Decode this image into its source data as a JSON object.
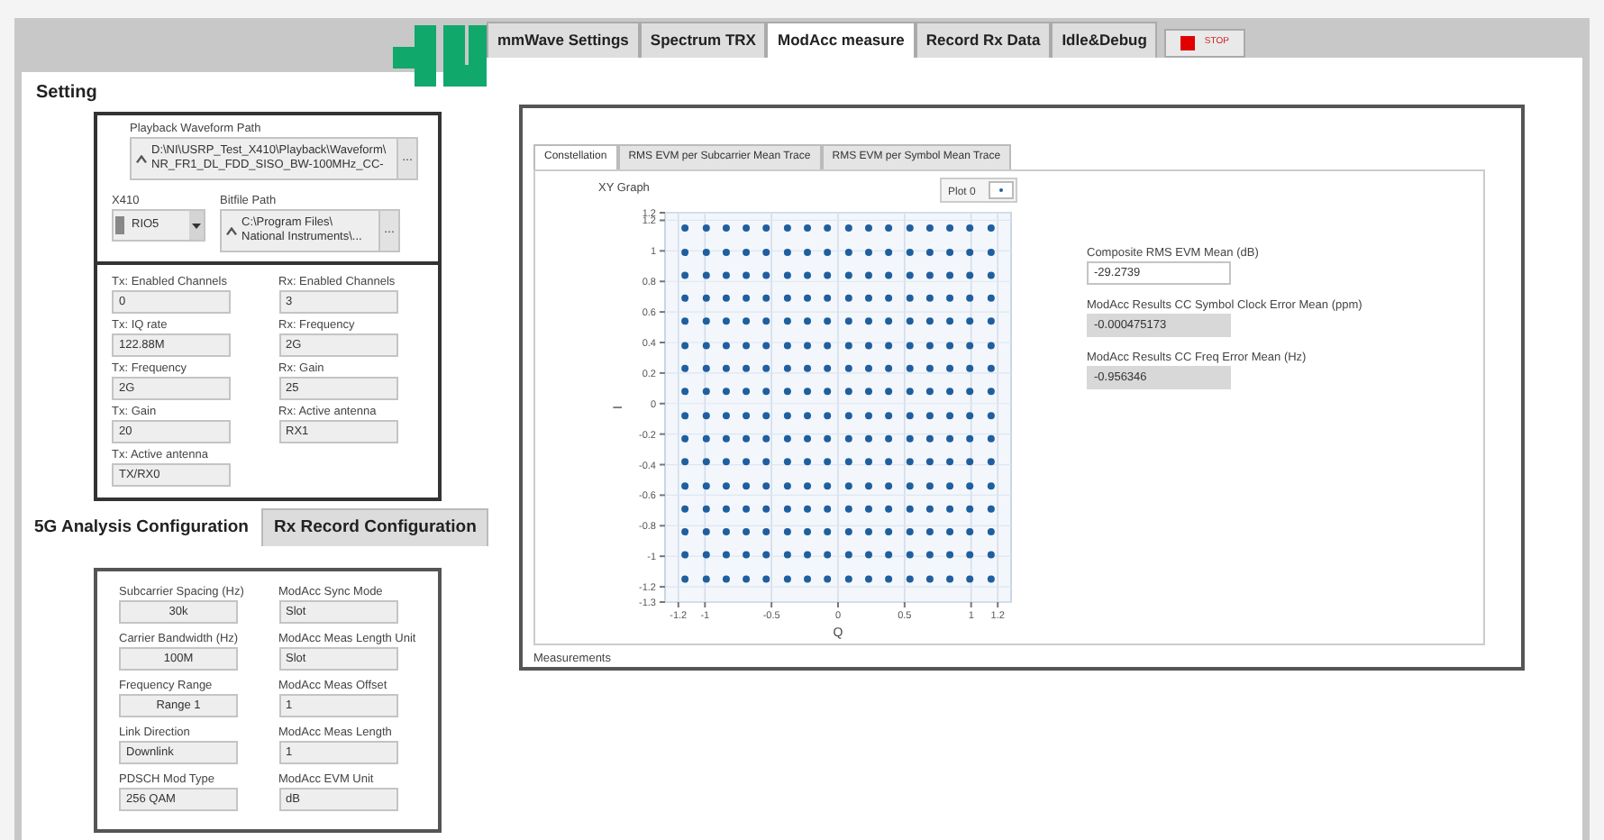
{
  "top_tabs": [
    {
      "label": "mmWave Settings",
      "selected": false
    },
    {
      "label": "Spectrum TRX",
      "selected": false
    },
    {
      "label": "ModAcc measure",
      "selected": true
    },
    {
      "label": "Record Rx Data",
      "selected": false
    },
    {
      "label": "Idle&Debug",
      "selected": false
    }
  ],
  "stop_button": {
    "label": "STOP"
  },
  "setting": {
    "title": "Setting",
    "playback_waveform_path": {
      "label": "Playback Waveform Path",
      "lines": [
        "D:\\NI\\USRP_Test_X410\\Playback\\Waveform\\",
        "NR_FR1_DL_FDD_SISO_BW-100MHz_CC-"
      ],
      "browse": "..."
    },
    "x410": {
      "label": "X410",
      "value": "RIO5"
    },
    "bitfile_path": {
      "label": "Bitfile Path",
      "lines": [
        "C:\\Program Files\\",
        "National Instruments\\..."
      ],
      "browse": "..."
    },
    "fields": [
      {
        "label": "Tx: Enabled Channels",
        "value": "0"
      },
      {
        "label": "Rx: Enabled Channels",
        "value": "3"
      },
      {
        "label": "Tx: IQ rate",
        "value": "122.88M"
      },
      {
        "label": "Rx: Frequency",
        "value": "2G"
      },
      {
        "label": "Tx: Frequency",
        "value": "2G"
      },
      {
        "label": "Rx: Gain",
        "value": "25"
      },
      {
        "label": "Tx: Gain",
        "value": "20"
      },
      {
        "label": "Rx: Active antenna",
        "value": "RX1"
      },
      {
        "label": "Tx: Active antenna",
        "value": "TX/RX0"
      }
    ]
  },
  "config_tabs": [
    {
      "label": "5G Analysis Configuration",
      "selected": true
    },
    {
      "label": "Rx Record Configuration",
      "selected": false
    }
  ],
  "analysis_fields": [
    {
      "label": "Subcarrier Spacing (Hz)",
      "value": "30k",
      "kind": "ring"
    },
    {
      "label": "ModAcc Sync Mode",
      "value": "Slot",
      "kind": "text"
    },
    {
      "label": "Carrier Bandwidth (Hz)",
      "value": "100M",
      "kind": "ring"
    },
    {
      "label": "ModAcc Meas Length Unit",
      "value": "Slot",
      "kind": "text"
    },
    {
      "label": "Frequency Range",
      "value": "Range 1",
      "kind": "ring"
    },
    {
      "label": "ModAcc Meas Offset",
      "value": "1",
      "kind": "text"
    },
    {
      "label": "Link Direction",
      "value": "Downlink",
      "kind": "text"
    },
    {
      "label": "ModAcc Meas Length",
      "value": "1",
      "kind": "text"
    },
    {
      "label": "PDSCH Mod Type",
      "value": "256 QAM",
      "kind": "text"
    },
    {
      "label": "ModAcc EVM Unit",
      "value": "dB",
      "kind": "text"
    }
  ],
  "modacc": {
    "tabs": [
      {
        "label": "Constellation",
        "selected": true
      },
      {
        "label": "RMS EVM per Subcarrier Mean Trace",
        "selected": false
      },
      {
        "label": "RMS EVM per Symbol Mean Trace",
        "selected": false
      }
    ],
    "graph": {
      "title": "XY Graph",
      "chart_data": {
        "type": "scatter",
        "xlabel": "Q",
        "ylabel": "I",
        "grid": true,
        "xlim": [
          -1.3,
          1.3
        ],
        "ylim": [
          -1.3,
          1.25
        ],
        "xticks": [
          -1.2,
          -1,
          -0.5,
          0,
          0.5,
          1,
          1.2
        ],
        "yticks": [
          {
            "value": 1.25,
            "label": "1.2"
          },
          1.2,
          1,
          0.8,
          0.6,
          0.4,
          0.2,
          0,
          -0.2,
          -0.4,
          -0.6,
          -0.8,
          -1,
          -1.2,
          -1.3
        ],
        "x": [
          -1.15,
          -0.99,
          -0.84,
          -0.69,
          -0.54,
          -0.38,
          -0.23,
          -0.08,
          0.08,
          0.23,
          0.38,
          0.54,
          0.69,
          0.84,
          0.99,
          1.15,
          -1.15,
          -0.99,
          -0.84,
          -0.69,
          -0.54,
          -0.38,
          -0.23,
          -0.08,
          0.08,
          0.23,
          0.38,
          0.54,
          0.69,
          0.84,
          0.99,
          1.15,
          -1.15,
          -0.99,
          -0.84,
          -0.69,
          -0.54,
          -0.38,
          -0.23,
          -0.08,
          0.08,
          0.23,
          0.38,
          0.54,
          0.69,
          0.84,
          0.99,
          1.15,
          -1.15,
          -0.99,
          -0.84,
          -0.69,
          -0.54,
          -0.38,
          -0.23,
          -0.08,
          0.08,
          0.23,
          0.38,
          0.54,
          0.69,
          0.84,
          0.99,
          1.15,
          -1.15,
          -0.99,
          -0.84,
          -0.69,
          -0.54,
          -0.38,
          -0.23,
          -0.08,
          0.08,
          0.23,
          0.38,
          0.54,
          0.69,
          0.84,
          0.99,
          1.15,
          -1.15,
          -0.99,
          -0.84,
          -0.69,
          -0.54,
          -0.38,
          -0.23,
          -0.08,
          0.08,
          0.23,
          0.38,
          0.54,
          0.69,
          0.84,
          0.99,
          1.15,
          -1.15,
          -0.99,
          -0.84,
          -0.69,
          -0.54,
          -0.38,
          -0.23,
          -0.08,
          0.08,
          0.23,
          0.38,
          0.54,
          0.69,
          0.84,
          0.99,
          1.15,
          -1.15,
          -0.99,
          -0.84,
          -0.69,
          -0.54,
          -0.38,
          -0.23,
          -0.08,
          0.08,
          0.23,
          0.38,
          0.54,
          0.69,
          0.84,
          0.99,
          1.15,
          -1.15,
          -0.99,
          -0.84,
          -0.69,
          -0.54,
          -0.38,
          -0.23,
          -0.08,
          0.08,
          0.23,
          0.38,
          0.54,
          0.69,
          0.84,
          0.99,
          1.15,
          -1.15,
          -0.99,
          -0.84,
          -0.69,
          -0.54,
          -0.38,
          -0.23,
          -0.08,
          0.08,
          0.23,
          0.38,
          0.54,
          0.69,
          0.84,
          0.99,
          1.15,
          -1.15,
          -0.99,
          -0.84,
          -0.69,
          -0.54,
          -0.38,
          -0.23,
          -0.08,
          0.08,
          0.23,
          0.38,
          0.54,
          0.69,
          0.84,
          0.99,
          1.15,
          -1.15,
          -0.99,
          -0.84,
          -0.69,
          -0.54,
          -0.38,
          -0.23,
          -0.08,
          0.08,
          0.23,
          0.38,
          0.54,
          0.69,
          0.84,
          0.99,
          1.15,
          -1.15,
          -0.99,
          -0.84,
          -0.69,
          -0.54,
          -0.38,
          -0.23,
          -0.08,
          0.08,
          0.23,
          0.38,
          0.54,
          0.69,
          0.84,
          0.99,
          1.15,
          -1.15,
          -0.99,
          -0.84,
          -0.69,
          -0.54,
          -0.38,
          -0.23,
          -0.08,
          0.08,
          0.23,
          0.38,
          0.54,
          0.69,
          0.84,
          0.99,
          1.15,
          -1.15,
          -0.99,
          -0.84,
          -0.69,
          -0.54,
          -0.38,
          -0.23,
          -0.08,
          0.08,
          0.23,
          0.38,
          0.54,
          0.69,
          0.84,
          0.99,
          1.15,
          -1.15,
          -0.99,
          -0.84,
          -0.69,
          -0.54,
          -0.38,
          -0.23,
          -0.08,
          0.08,
          0.23,
          0.38,
          0.54,
          0.69,
          0.84,
          0.99,
          1.15
        ],
        "series": [
          {
            "name": "Plot 0",
            "color": "#1f5f9f",
            "values": [
              1.15,
              1.15,
              1.15,
              1.15,
              1.15,
              1.15,
              1.15,
              1.15,
              1.15,
              1.15,
              1.15,
              1.15,
              1.15,
              1.15,
              1.15,
              1.15,
              0.99,
              0.99,
              0.99,
              0.99,
              0.99,
              0.99,
              0.99,
              0.99,
              0.99,
              0.99,
              0.99,
              0.99,
              0.99,
              0.99,
              0.99,
              0.99,
              0.84,
              0.84,
              0.84,
              0.84,
              0.84,
              0.84,
              0.84,
              0.84,
              0.84,
              0.84,
              0.84,
              0.84,
              0.84,
              0.84,
              0.84,
              0.84,
              0.69,
              0.69,
              0.69,
              0.69,
              0.69,
              0.69,
              0.69,
              0.69,
              0.69,
              0.69,
              0.69,
              0.69,
              0.69,
              0.69,
              0.69,
              0.69,
              0.54,
              0.54,
              0.54,
              0.54,
              0.54,
              0.54,
              0.54,
              0.54,
              0.54,
              0.54,
              0.54,
              0.54,
              0.54,
              0.54,
              0.54,
              0.54,
              0.38,
              0.38,
              0.38,
              0.38,
              0.38,
              0.38,
              0.38,
              0.38,
              0.38,
              0.38,
              0.38,
              0.38,
              0.38,
              0.38,
              0.38,
              0.38,
              0.23,
              0.23,
              0.23,
              0.23,
              0.23,
              0.23,
              0.23,
              0.23,
              0.23,
              0.23,
              0.23,
              0.23,
              0.23,
              0.23,
              0.23,
              0.23,
              0.08,
              0.08,
              0.08,
              0.08,
              0.08,
              0.08,
              0.08,
              0.08,
              0.08,
              0.08,
              0.08,
              0.08,
              0.08,
              0.08,
              0.08,
              0.08,
              -0.08,
              -0.08,
              -0.08,
              -0.08,
              -0.08,
              -0.08,
              -0.08,
              -0.08,
              -0.08,
              -0.08,
              -0.08,
              -0.08,
              -0.08,
              -0.08,
              -0.08,
              -0.08,
              -0.23,
              -0.23,
              -0.23,
              -0.23,
              -0.23,
              -0.23,
              -0.23,
              -0.23,
              -0.23,
              -0.23,
              -0.23,
              -0.23,
              -0.23,
              -0.23,
              -0.23,
              -0.23,
              -0.38,
              -0.38,
              -0.38,
              -0.38,
              -0.38,
              -0.38,
              -0.38,
              -0.38,
              -0.38,
              -0.38,
              -0.38,
              -0.38,
              -0.38,
              -0.38,
              -0.38,
              -0.38,
              -0.54,
              -0.54,
              -0.54,
              -0.54,
              -0.54,
              -0.54,
              -0.54,
              -0.54,
              -0.54,
              -0.54,
              -0.54,
              -0.54,
              -0.54,
              -0.54,
              -0.54,
              -0.54,
              -0.69,
              -0.69,
              -0.69,
              -0.69,
              -0.69,
              -0.69,
              -0.69,
              -0.69,
              -0.69,
              -0.69,
              -0.69,
              -0.69,
              -0.69,
              -0.69,
              -0.69,
              -0.69,
              -0.84,
              -0.84,
              -0.84,
              -0.84,
              -0.84,
              -0.84,
              -0.84,
              -0.84,
              -0.84,
              -0.84,
              -0.84,
              -0.84,
              -0.84,
              -0.84,
              -0.84,
              -0.84,
              -0.99,
              -0.99,
              -0.99,
              -0.99,
              -0.99,
              -0.99,
              -0.99,
              -0.99,
              -0.99,
              -0.99,
              -0.99,
              -0.99,
              -0.99,
              -0.99,
              -0.99,
              -0.99,
              -1.15,
              -1.15,
              -1.15,
              -1.15,
              -1.15,
              -1.15,
              -1.15,
              -1.15,
              -1.15,
              -1.15,
              -1.15,
              -1.15,
              -1.15,
              -1.15,
              -1.15,
              -1.15
            ]
          }
        ]
      }
    },
    "indicators": [
      {
        "label": "Composite RMS EVM Mean (dB)",
        "value": "-29.2739",
        "kind": "control"
      },
      {
        "label": "ModAcc Results CC Symbol Clock Error Mean (ppm)",
        "value": "-0.000475173",
        "kind": "indicator"
      },
      {
        "label": "ModAcc Results CC Freq Error Mean (Hz)",
        "value": "-0.956346",
        "kind": "indicator"
      }
    ],
    "section_label": "Measurements"
  }
}
